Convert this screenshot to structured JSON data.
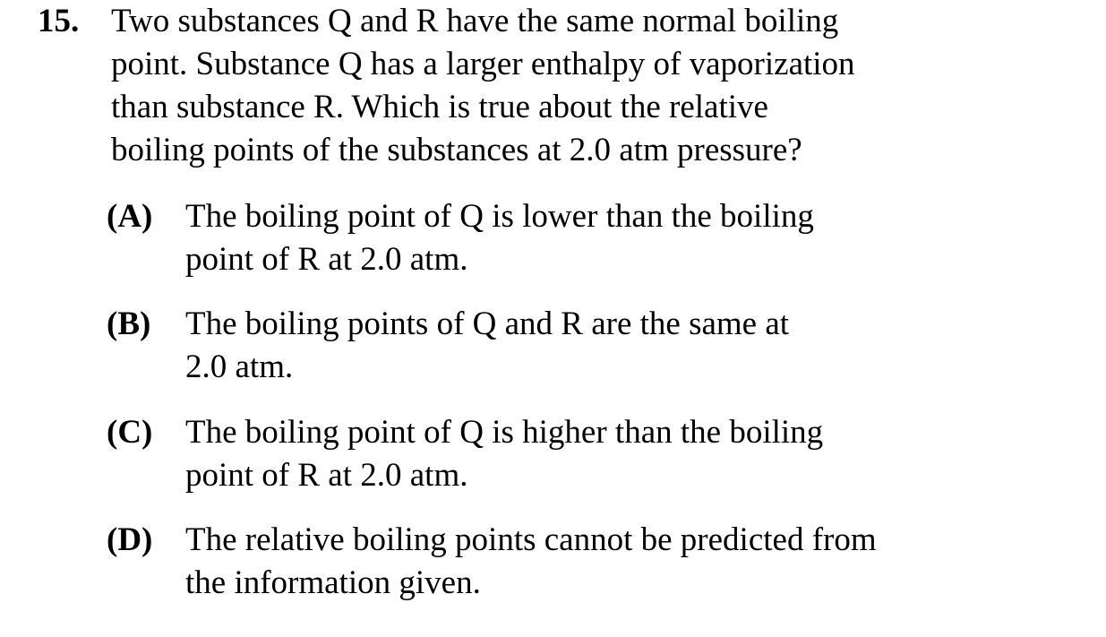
{
  "question": {
    "number": "15.",
    "stem_lines": [
      "Two substances Q and R have the same normal boiling",
      "point.  Substance Q has a larger enthalpy of vaporization",
      "than substance R.  Which is true about the relative",
      "boiling points of the substances at 2.0 atm pressure?"
    ],
    "choices": [
      {
        "letter": "(A)",
        "lines": [
          "The boiling point of Q is lower than the boiling",
          "point of R at 2.0 atm."
        ]
      },
      {
        "letter": "(B)",
        "lines": [
          "The boiling points of Q and R are the same at",
          "2.0 atm."
        ]
      },
      {
        "letter": "(C)",
        "lines": [
          "The boiling point of Q is higher than the boiling",
          "point of R at 2.0 atm."
        ]
      },
      {
        "letter": "(D)",
        "lines": [
          "The relative boiling points cannot be predicted from",
          "the information given."
        ]
      }
    ]
  }
}
